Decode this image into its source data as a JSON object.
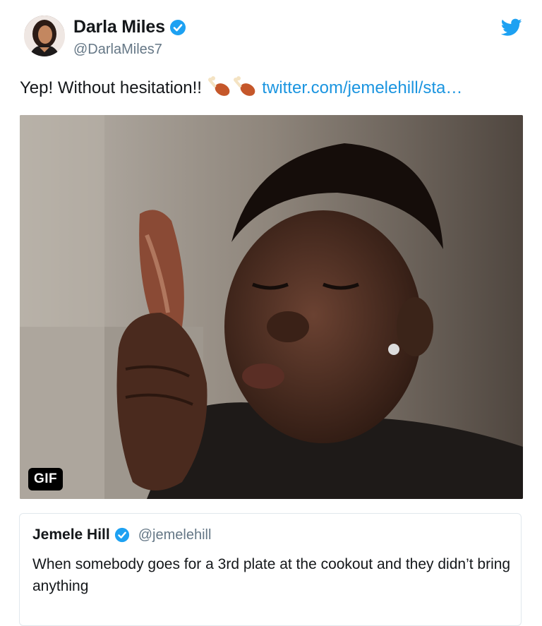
{
  "tweet": {
    "author": {
      "display_name": "Darla Miles",
      "handle": "@DarlaMiles7",
      "verified": true,
      "avatar_icon": "profile-photo"
    },
    "brand_icon": "twitter-bird-icon",
    "text_prefix": "Yep! Without hesitation!!",
    "emojis": [
      "poultry-leg-emoji",
      "poultry-leg-emoji"
    ],
    "link_text": "twitter.com/jemelehill/sta…",
    "media": {
      "badge": "GIF",
      "description_icon": "gif-media"
    }
  },
  "quoted_tweet": {
    "display_name": "Jemele Hill",
    "handle": "@jemelehill",
    "verified": true,
    "text": "When somebody goes for a 3rd plate at the cookout and they didn’t bring anything"
  },
  "colors": {
    "link": "#1b95e0",
    "verified": "#1da1f2",
    "muted": "#657786",
    "border": "#e1e8ed"
  }
}
